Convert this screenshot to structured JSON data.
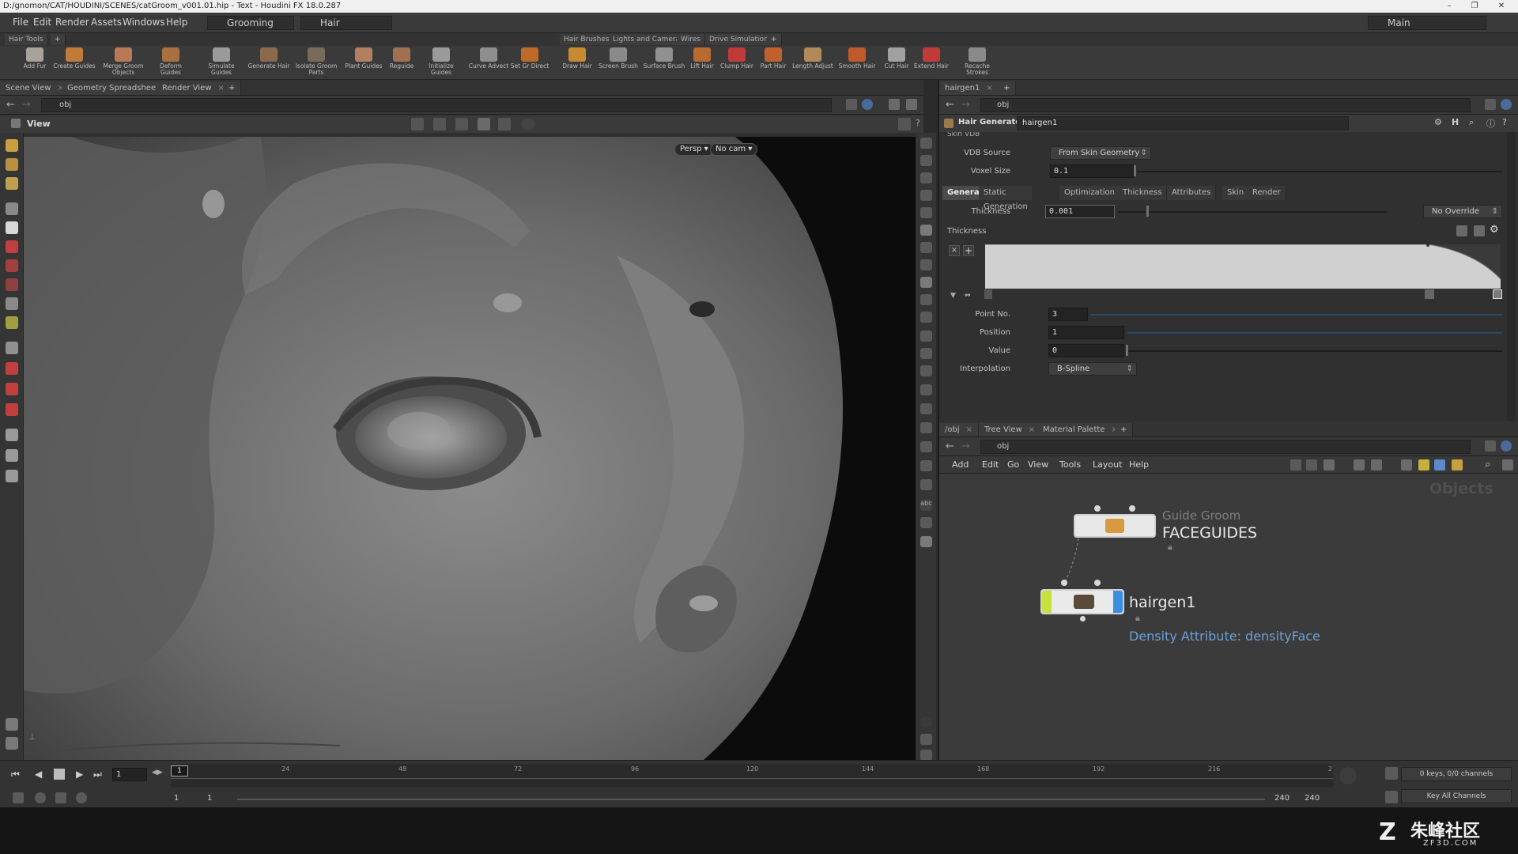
{
  "window": {
    "title": "D:/gnomon/CAT/HOUDINI/SCENES/catGroom_v001.01.hip - Text - Houdini FX 18.0.287"
  },
  "menubar": {
    "items": [
      "File",
      "Edit",
      "Render",
      "Assets",
      "Windows",
      "Help"
    ],
    "desktop": "Grooming",
    "context": "Hair",
    "layout": "Main"
  },
  "shelf": {
    "left_tab": "Hair Tools",
    "right_tabs": [
      "Hair Brushes",
      "Lights and Cameras",
      "Wires",
      "Drive Simulation"
    ],
    "tools_left": [
      "Add Fur",
      "Create Guides",
      "Merge Groom Objects",
      "Deform Guides",
      "Simulate Guides",
      "Generate Hair",
      "Isolate Groom Parts",
      "Plant Guides",
      "Reguide",
      "Initialize Guides",
      "Curve Advect",
      "Set Gr Direct"
    ],
    "tools_right": [
      "Draw Hair",
      "Screen Brush",
      "Surface Brush",
      "Lift Hair",
      "Clump Hair",
      "Part Hair",
      "Length Adjust",
      "Smooth Hair",
      "Cut Hair",
      "Extend Hair",
      "Recache Strokes"
    ]
  },
  "left_pane": {
    "tabs": [
      "Scene View",
      "Geometry Spreadsheet",
      "Render View"
    ],
    "path": "obj",
    "viewport_label": "View",
    "camera_menu": "Persp",
    "cam_menu": "No cam"
  },
  "params": {
    "tab": "hairgen1",
    "path": "obj",
    "node_type": "Hair Generate",
    "node_name": "hairgen1",
    "section_cut": "Skin VDB",
    "vdb_source_label": "VDB Source",
    "vdb_source_value": "From Skin Geometry",
    "voxel_size_label": "Voxel Size",
    "voxel_size_value": "0.1",
    "tabs": [
      "General",
      "Static Generation",
      "Optimization",
      "Thickness",
      "Attributes",
      "Skin",
      "Render"
    ],
    "thickness_label": "Thickness",
    "thickness_value": "0.001",
    "override": "No Override",
    "ramp_label": "Thickness",
    "point_no_label": "Point No.",
    "point_no_value": "3",
    "position_label": "Position",
    "position_value": "1",
    "value_label": "Value",
    "value_value": "0",
    "interp_label": "Interpolation",
    "interp_value": "B-Spline"
  },
  "network": {
    "tabs": [
      "/obj",
      "Tree View",
      "Material Palette"
    ],
    "path": "obj",
    "menu": [
      "Add",
      "Edit",
      "Go",
      "View",
      "Tools",
      "Layout",
      "Help"
    ],
    "context_label": "Objects",
    "node1_type": "Guide Groom",
    "node1_name": "FACEGUIDES",
    "node2_name": "hairgen1",
    "node2_note": "Density Attribute: densityFace"
  },
  "timeline": {
    "frame": "1",
    "marker": "1",
    "ticks": [
      "24",
      "48",
      "72",
      "96",
      "120",
      "144",
      "168",
      "192",
      "216",
      "2"
    ],
    "range_start": "1",
    "range_start2": "1",
    "range_end": "240",
    "range_end2": "240",
    "keys_info": "0 keys, 0/0 channels",
    "key_all": "Key All Channels"
  },
  "watermark": {
    "text": "朱峰社区",
    "sub": "ZF3D.COM"
  },
  "colors": {
    "accent_green": "#c6e23a",
    "accent_blue": "#3a8fe0",
    "note_blue": "#6aa0d8"
  }
}
